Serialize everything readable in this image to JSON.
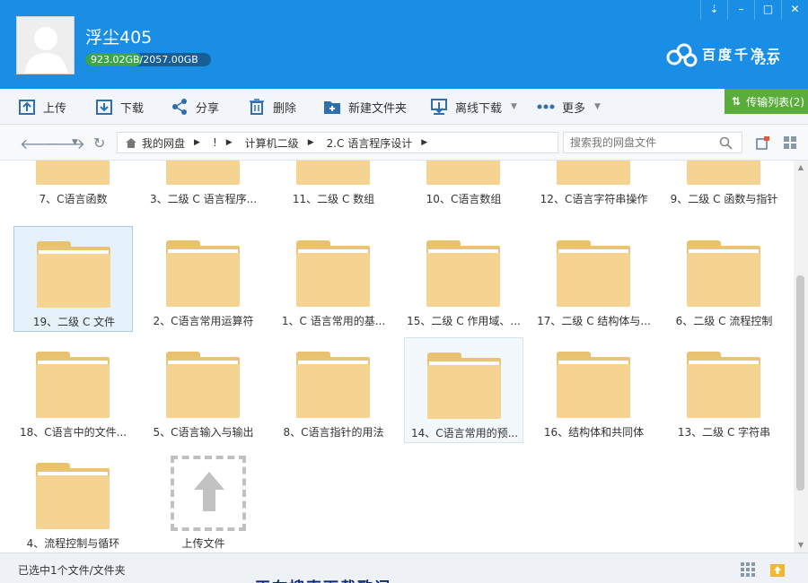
{
  "header": {
    "username": "浮尘405",
    "quota_text": "923.02GB/2057.00GB",
    "quota_fraction": 0.449,
    "logo_text": "百度千净云",
    "logo_version": "v2.0",
    "window_buttons": [
      "⇣",
      "–",
      "□",
      "✕"
    ]
  },
  "toolbar": {
    "upload": "上传",
    "download": "下载",
    "share": "分享",
    "delete": "删除",
    "new_folder": "新建文件夹",
    "offline_download": "离线下载",
    "more": "更多",
    "transfer_list": "传输列表(2)"
  },
  "nav": {
    "crumbs": [
      "我的网盘",
      "!",
      "计算机二级",
      "2.C 语言程序设计"
    ],
    "search_placeholder": "搜索我的网盘文件"
  },
  "rows": [
    {
      "items": [
        {
          "label": "7、C语言函数"
        },
        {
          "label": "3、二级 C 语言程序..."
        },
        {
          "label": "11、二级 C 数组"
        },
        {
          "label": "10、C语言数组"
        },
        {
          "label": "12、C语言字符串操作"
        },
        {
          "label": "9、二级 C 函数与指针"
        }
      ]
    },
    {
      "items": [
        {
          "label": "19、二级 C 文件"
        },
        {
          "label": "2、C语言常用运算符"
        },
        {
          "label": "1、C 语言常用的基..."
        },
        {
          "label": "15、二级 C 作用域、..."
        },
        {
          "label": "17、二级 C 结构体与..."
        },
        {
          "label": "6、二级 C 流程控制"
        }
      ]
    },
    {
      "items": [
        {
          "label": "18、C语言中的文件..."
        },
        {
          "label": "5、C语言输入与输出"
        },
        {
          "label": "8、C语言指针的用法"
        },
        {
          "label": "14、C语言常用的预..."
        },
        {
          "label": "16、结构体和共同体"
        },
        {
          "label": "13、二级 C 字符串"
        }
      ]
    },
    {
      "items": [
        {
          "label": "4、流程控制与循环"
        }
      ]
    }
  ],
  "upload_tile": {
    "label": "上传文件"
  },
  "status": {
    "text": "已选中1个文件/文件夹",
    "overlay": "正在搜索下载歌词"
  },
  "colors": {
    "header": "#1a8ee5",
    "transfer_button": "#5aad3b",
    "folder": "#f4d490"
  }
}
